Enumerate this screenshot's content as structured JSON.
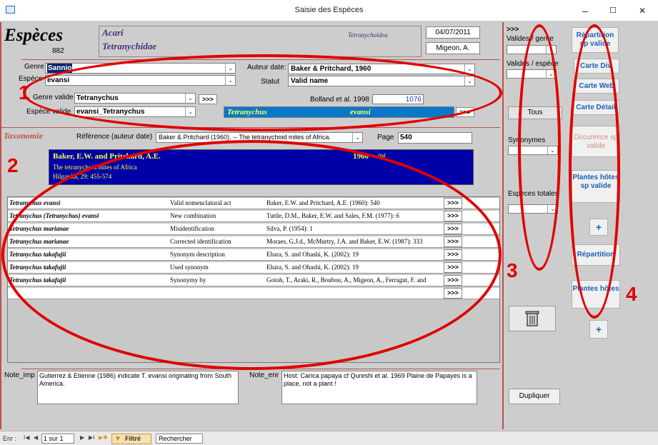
{
  "window": {
    "title": "Saisie des Espèces",
    "minimize": "–",
    "maximize": "☐",
    "close": "✕"
  },
  "header": {
    "form_title": "Espèces",
    "record_number": "882",
    "subclass": "Acari",
    "family": "Tetranychidae",
    "superfamily": "Tetranychoidea",
    "date": "04/07/2011",
    "author_initials": "Migeon, A."
  },
  "species": {
    "genre_label": "Genre",
    "genre_value": "Sannio",
    "espece_label": "Espèce",
    "espece_value": "evansi",
    "auteur_label": "Auteur date:",
    "auteur_value": "Baker & Pritchard, 1960",
    "statut_label": "Statut",
    "statut_value": "Valid name",
    "genre_valide_label": "Genre valide",
    "genre_valide_value": "Tetranychus",
    "espece_valide_label": "Espèce valide",
    "espece_valide_value": "evansi_Tetranychus",
    "bolland_label": "Bolland et al. 1998 :",
    "bolland_value": "1076",
    "valid_genus": "Tetranychus",
    "valid_species": "evansi",
    "arrow": ">>>"
  },
  "taxonomy": {
    "section_label": "Taxonomie",
    "reference_label": "Référence (auteur date)",
    "reference_value": "Baker & Pritchard (1960). -- The tetranychoid mites of Africa.",
    "page_label": "Page",
    "page_value": "540",
    "ref_authors": "Baker, E.W. and Pritchard, A.E.",
    "ref_year": "1960",
    "ref_oui": "oui",
    "ref_title": "The tetranychoid mites of Africa",
    "ref_journal": "Hilgardia, 29: 455-574"
  },
  "synonyms_table": {
    "rows": [
      {
        "name": "Tetranychus evansi",
        "act": "Valid nomenclatural act",
        "ref": "Baker, E.W. and Pritchard, A.E. (1960): 540",
        "btn": ">>>"
      },
      {
        "name": "Tetranychus (Tetranychus) evansi",
        "act": "New combination",
        "ref": "Tuttle, D.M., Baker, E.W. and Sales, F.M. (1977): 6",
        "btn": ">>>"
      },
      {
        "name": "Tetranychus marianae",
        "act": "Misidentification",
        "ref": "Silva, P. (1954): 1",
        "btn": ">>>"
      },
      {
        "name": "Tetranychus marianae",
        "act": "Corrected identification",
        "ref": "Moraes, G.J.d., McMurtry, J.A. and Baker, E.W. (1987): 333",
        "btn": ">>>"
      },
      {
        "name": "Tetranychus takafujii",
        "act": "Synonym description",
        "ref": "Ehara, S. and Ohashi, K. (2002): 19",
        "btn": ">>>"
      },
      {
        "name": "Tetranychus takafujii",
        "act": "Used synonym",
        "ref": "Ehara, S. and Ohashi, K. (2002): 19",
        "btn": ">>>"
      },
      {
        "name": "Tetranychus takafujii",
        "act": "Synonymy by",
        "ref": "Gotoh, T., Araki, R., Boubou, A., Migeon, A., Ferragut, F. and",
        "btn": ">>>"
      },
      {
        "name": "",
        "act": "",
        "ref": "",
        "btn": ">>>"
      }
    ]
  },
  "notes": {
    "note_imp_label": "Note_imp",
    "note_imp_value": "Gutierrez & Etienne (1986) indicate T. evansi originating from South America.",
    "note_enr_label": "Note_enr",
    "note_enr_value": "Host: Carica papaya cf Qureshi et al. 1969 Plaine de Papayes is a place, not a plant !"
  },
  "side_panel": {
    "arrow": ">>>",
    "valides_genre_label": "Valides / genre",
    "valides_espece_label": "Valides / espèce",
    "tous_label": "Tous",
    "synonymes_label": "Synonymes",
    "especes_totales_label": "Especes totales",
    "dupliquer_label": "Dupliquer"
  },
  "right_buttons": {
    "repartition_valide": "Répartition sp valide",
    "carte_div": "Carte Div.",
    "carte_web": "Carte Web",
    "carte_detail": "Carte Détail",
    "occurence_valide": "Occurence sp valide",
    "plantes_hotes_valide": "Plantes hôtes sp valide",
    "plus1": "+",
    "repartition": "Répartition",
    "plantes_hotes": "Plantes hôtes",
    "plus2": "+"
  },
  "navbar": {
    "enr_label": "Enr :",
    "record_position": "1 sur 1",
    "filter_label": "Filtré",
    "search_label": "Rechercher"
  },
  "annotations": {
    "n1": "1",
    "n2": "2",
    "n3": "3",
    "n4": "4"
  },
  "colors": {
    "highlight_blue": "#0000a8",
    "cyan_bar": "#0078c8",
    "annotation_red": "#e00000",
    "section_red": "#c0504d"
  }
}
